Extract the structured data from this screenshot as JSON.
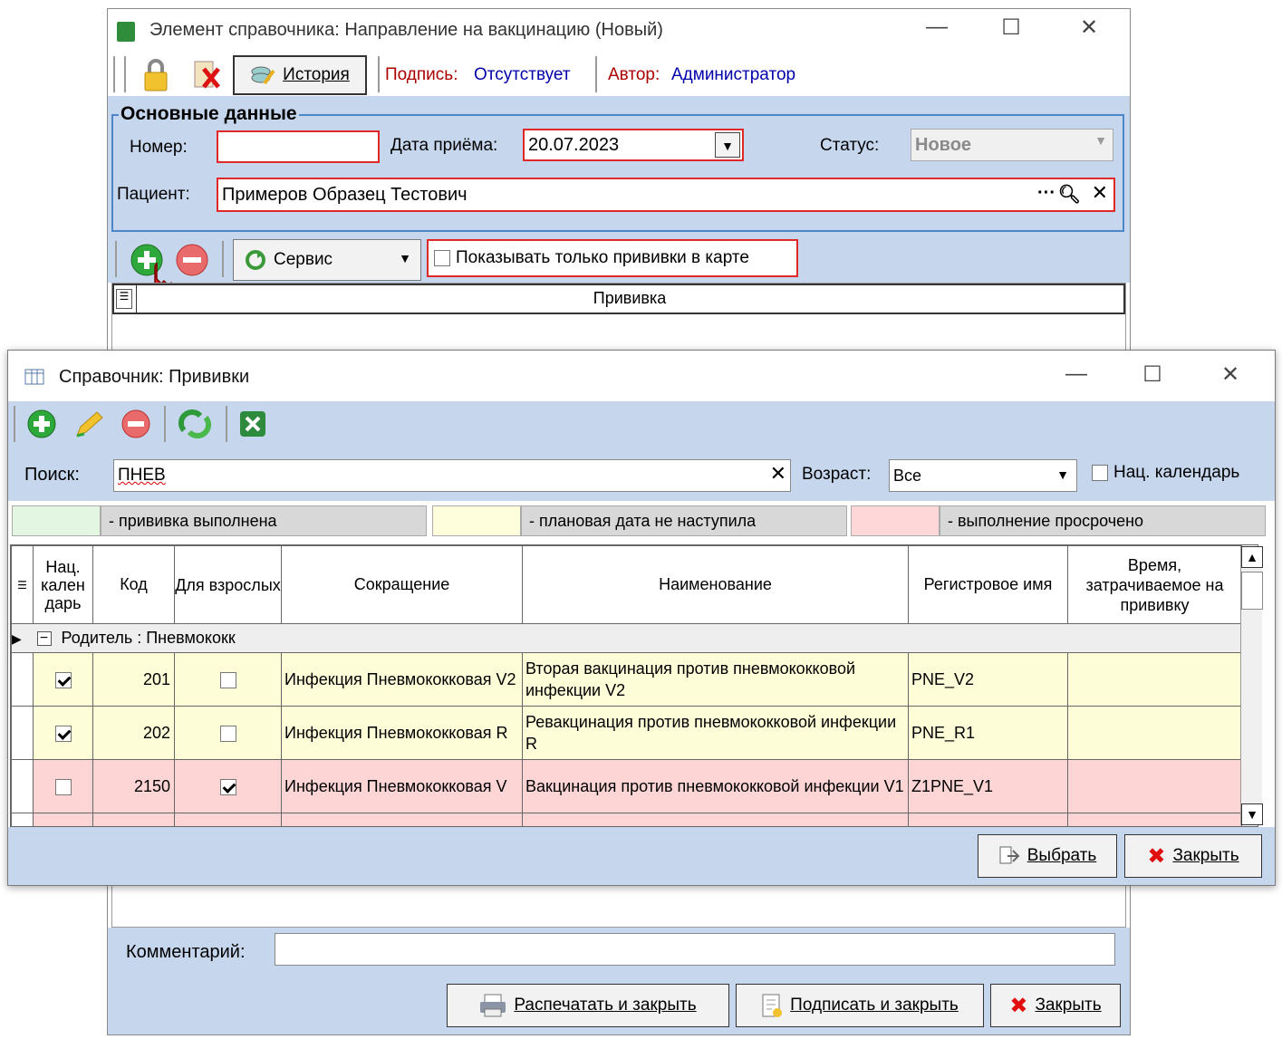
{
  "back_window": {
    "title": "Элемент справочника: Направление на вакцинацию (Новый)",
    "toolbar": {
      "history_label": "История",
      "signature_label": "Подпись:",
      "signature_value": "Отсутствует",
      "author_label": "Автор:",
      "author_value": "Администратор"
    },
    "main_group_title": "Основные данные",
    "number_label": "Номер:",
    "number_value": "",
    "date_label": "Дата приёма:",
    "date_value": "20.07.2023",
    "status_label": "Статус:",
    "status_value": "Новое",
    "patient_label": "Пациент:",
    "patient_value": "Примеров Образец Тестович",
    "grid_toolbar": {
      "service_label": "Сервис",
      "show_only_label": "Показывать только прививки в карте"
    },
    "grid_header": "Прививка",
    "comment_label": "Комментарий:",
    "comment_value": "",
    "buttons": {
      "print_close": "Распечатать и закрыть",
      "sign_close": "Подписать и закрыть",
      "close": "Закрыть"
    }
  },
  "front_window": {
    "title": "Справочник: Прививки",
    "search_label": "Поиск:",
    "search_value": "ПНЕВ",
    "age_label": "Возраст:",
    "age_value": "Все",
    "nat_calendar_label": "Нац. календарь",
    "legend": {
      "done": "- прививка выполнена",
      "planned": "- плановая дата не наступила",
      "overdue": "- выполнение просрочено"
    },
    "columns": {
      "nat": "Нац. кален дарь",
      "code": "Код",
      "adult": "Для взрослых",
      "short": "Сокращение",
      "name": "Наименование",
      "reg": "Регистровое имя",
      "time": "Время, затрачиваемое на прививку"
    },
    "group_row": "Родитель : Пневмококк",
    "rows": [
      {
        "nat": true,
        "code": "201",
        "adult": false,
        "short": "Инфекция Пневмококковая V2",
        "name": "Вторая вакцинация против пневмококковой инфекции V2",
        "reg": "PNE_V2",
        "time": "",
        "status": "planned"
      },
      {
        "nat": true,
        "code": "202",
        "adult": false,
        "short": "Инфекция Пневмококковая R",
        "name": "Ревакцинация против пневмококковой инфекции R",
        "reg": "PNE_R1",
        "time": "",
        "status": "planned"
      },
      {
        "nat": false,
        "code": "2150",
        "adult": true,
        "short": "Инфекция Пневмококковая V",
        "name": "Вакцинация против пневмококковой инфекции V1",
        "reg": "Z1PNE_V1",
        "time": "",
        "status": "overdue"
      }
    ],
    "buttons": {
      "select": "Выбрать",
      "close": "Закрыть"
    }
  },
  "colors": {
    "panel_blue": "#c5d6ed",
    "row_planned": "#fdfdd8",
    "row_overdue": "#fdd5d5",
    "legend_done": "#e2f6e2",
    "legend_planned": "#fefedc",
    "legend_overdue": "#fed8d8",
    "required_border": "#e02828"
  }
}
